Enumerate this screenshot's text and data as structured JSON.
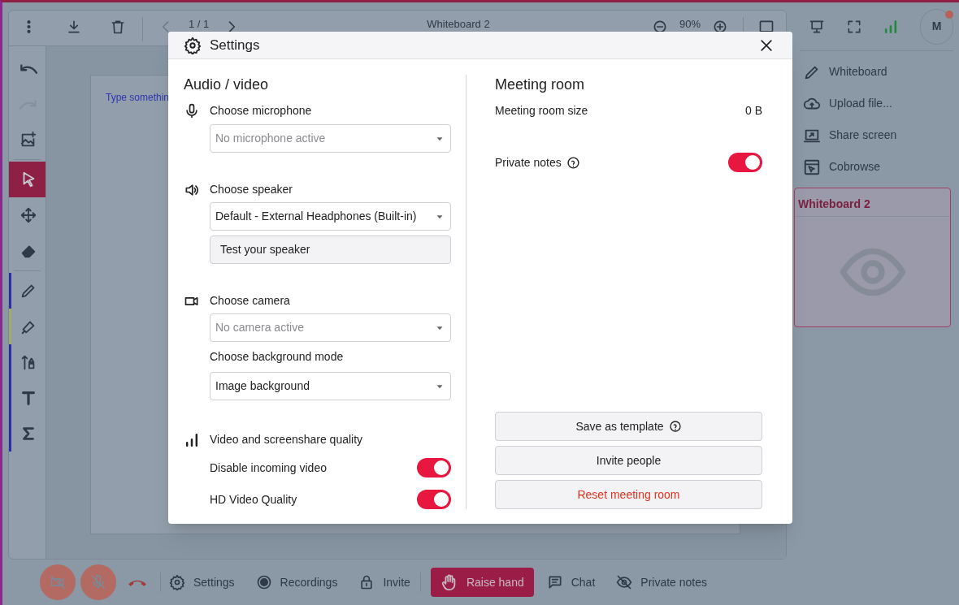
{
  "toolbar": {
    "page_counter": "1 / 1",
    "title": "Whiteboard 2",
    "zoom": "90%"
  },
  "tools": [
    {
      "kind": "undo",
      "selected": false,
      "disabled": false
    },
    {
      "kind": "redo",
      "selected": false,
      "disabled": true
    },
    {
      "kind": "image",
      "selected": false,
      "disabled": false
    },
    {
      "kind": "select",
      "selected": true,
      "disabled": false
    },
    {
      "kind": "move",
      "selected": false,
      "disabled": false
    },
    {
      "kind": "eraser",
      "selected": false,
      "disabled": false
    },
    {
      "kind": "pen",
      "selected": false,
      "disabled": false,
      "color": "#2a2fa8"
    },
    {
      "kind": "highlighter",
      "selected": false,
      "disabled": false,
      "color": "#a8a86a"
    },
    {
      "kind": "shapes",
      "selected": false,
      "disabled": false,
      "color": "#2a2fa8"
    },
    {
      "kind": "text",
      "selected": false,
      "disabled": false,
      "color": "#2a2fa8"
    },
    {
      "kind": "formula",
      "selected": false,
      "disabled": false,
      "color": "#2a2fa8"
    }
  ],
  "canvas": {
    "placeholder": "Type somethin"
  },
  "sidebar": {
    "avatar": "M",
    "items": [
      {
        "kind": "whiteboard",
        "label": "Whiteboard"
      },
      {
        "kind": "upload",
        "label": "Upload file..."
      },
      {
        "kind": "share",
        "label": "Share screen"
      },
      {
        "kind": "cobrowse",
        "label": "Cobrowse"
      }
    ],
    "whiteboard_card": {
      "title": "Whiteboard 2"
    }
  },
  "bottom_bar": [
    {
      "kind": "camera"
    },
    {
      "kind": "mic"
    },
    {
      "kind": "hangup"
    },
    {
      "kind": "settings",
      "label": "Settings"
    },
    {
      "kind": "recordings",
      "label": "Recordings"
    },
    {
      "kind": "invite",
      "label": "Invite"
    },
    {
      "kind": "raise",
      "label": "Raise hand"
    },
    {
      "kind": "chat",
      "label": "Chat"
    },
    {
      "kind": "notes",
      "label": "Private notes"
    }
  ],
  "dialog": {
    "title": "Settings",
    "audio_video": {
      "heading": "Audio / video",
      "microphone": {
        "label": "Choose microphone",
        "value": "No microphone active",
        "disabled": true
      },
      "speaker": {
        "label": "Choose speaker",
        "value": "Default - External Headphones (Built-in)",
        "disabled": false,
        "test_button": "Test your speaker"
      },
      "camera": {
        "label": "Choose camera",
        "value": "No camera active",
        "disabled": true
      },
      "background": {
        "label": "Choose background mode",
        "value": "Image background",
        "disabled": false
      },
      "quality": {
        "label": "Video and screenshare quality",
        "toggles": [
          {
            "label": "Disable incoming video",
            "on": true
          },
          {
            "label": "HD Video Quality",
            "on": true
          }
        ]
      }
    },
    "meeting_room": {
      "heading": "Meeting room",
      "size_label": "Meeting room size",
      "size_value": "0 B",
      "private_notes": {
        "label": "Private notes",
        "on": true
      },
      "buttons": [
        {
          "kind": "normal",
          "label": "Save as template",
          "help": true
        },
        {
          "kind": "normal",
          "label": "Invite people",
          "help": false
        },
        {
          "kind": "danger",
          "label": "Reset meeting room",
          "help": false
        }
      ]
    }
  }
}
